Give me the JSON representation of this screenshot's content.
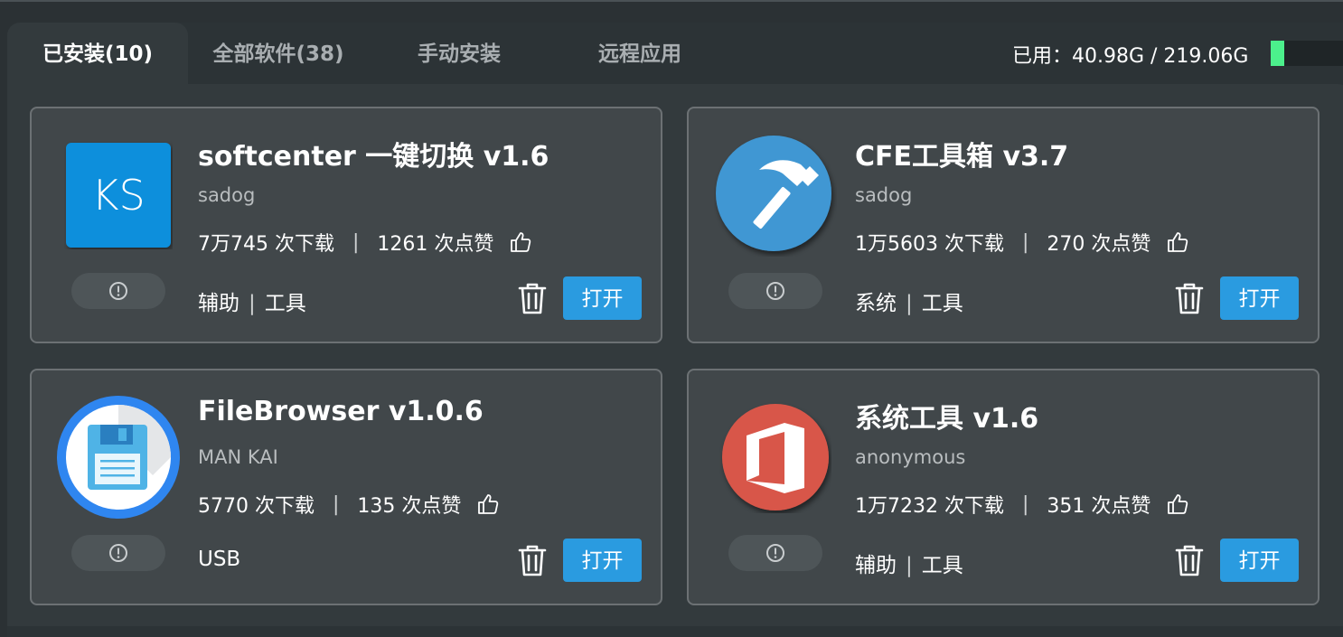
{
  "tabs": [
    {
      "label": "已安装(10)",
      "active": true
    },
    {
      "label": "全部软件(38)",
      "active": false
    },
    {
      "label": "手动安装",
      "active": false
    },
    {
      "label": "远程应用",
      "active": false
    }
  ],
  "usage": {
    "text": "已用：40.98G / 219.06G",
    "used_fraction": 0.187
  },
  "apps": [
    {
      "name": "softcenter 一键切换 v1.6",
      "author": "sadog",
      "downloads": "7万745 次下载",
      "likes": "1261 次点赞",
      "tags": [
        "辅助",
        "工具"
      ],
      "open_label": "打开",
      "icon": "ks-logo-icon",
      "icon_text": "KS"
    },
    {
      "name": "CFE工具箱 v3.7",
      "author": "sadog",
      "downloads": "1万5603 次下载",
      "likes": "270 次点赞",
      "tags": [
        "系统",
        "工具"
      ],
      "open_label": "打开",
      "icon": "hammer-icon"
    },
    {
      "name": "FileBrowser v1.0.6",
      "author": "MAN KAI",
      "downloads": "5770 次下载",
      "likes": "135 次点赞",
      "tags": [
        "USB"
      ],
      "open_label": "打开",
      "icon": "floppy-disk-icon"
    },
    {
      "name": "系统工具 v1.6",
      "author": "anonymous",
      "downloads": "1万7232 次下载",
      "likes": "351 次点赞",
      "tags": [
        "辅助",
        "工具"
      ],
      "open_label": "打开",
      "icon": "office-icon"
    }
  ],
  "separator": "|",
  "colors": {
    "accent": "#2a9be0",
    "usage_fill": "#4cf08c",
    "card_bg": "#41474a"
  }
}
